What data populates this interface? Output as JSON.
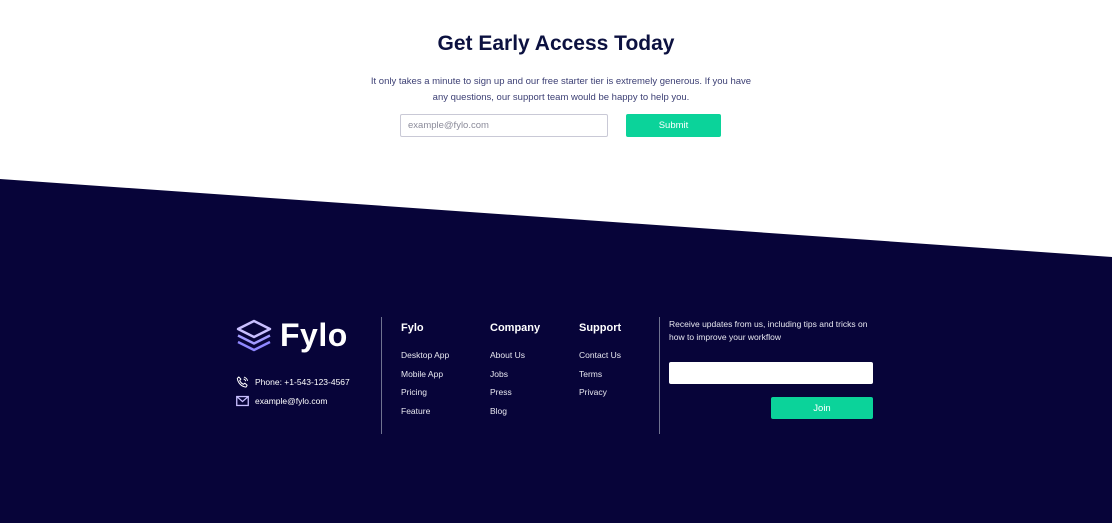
{
  "cta": {
    "title": "Get Early Access Today",
    "description": "It only takes a minute to sign up and our free starter tier is extremely generous. If you have any questions, our support team would be happy to help you.",
    "email_placeholder": "example@fylo.com",
    "submit_label": "Submit"
  },
  "footer": {
    "brand": "Fylo",
    "phone": "Phone: +1-543-123-4567",
    "email": "example@fylo.com",
    "columns": [
      {
        "title": "Fylo",
        "links": [
          "Desktop App",
          "Mobile App",
          "Pricing",
          "Feature"
        ]
      },
      {
        "title": "Company",
        "links": [
          "About Us",
          "Jobs",
          "Press",
          "Blog"
        ]
      },
      {
        "title": "Support",
        "links": [
          "Contact Us",
          "Terms",
          "Privacy"
        ]
      }
    ],
    "newsletter_text": "Receive updates from us, including tips and tricks on how to improve your workflow",
    "newsletter_value": "",
    "join_label": "Join"
  },
  "colors": {
    "footer_bg": "#070439",
    "accent": "#0bd39a",
    "heading": "#0c1140"
  }
}
